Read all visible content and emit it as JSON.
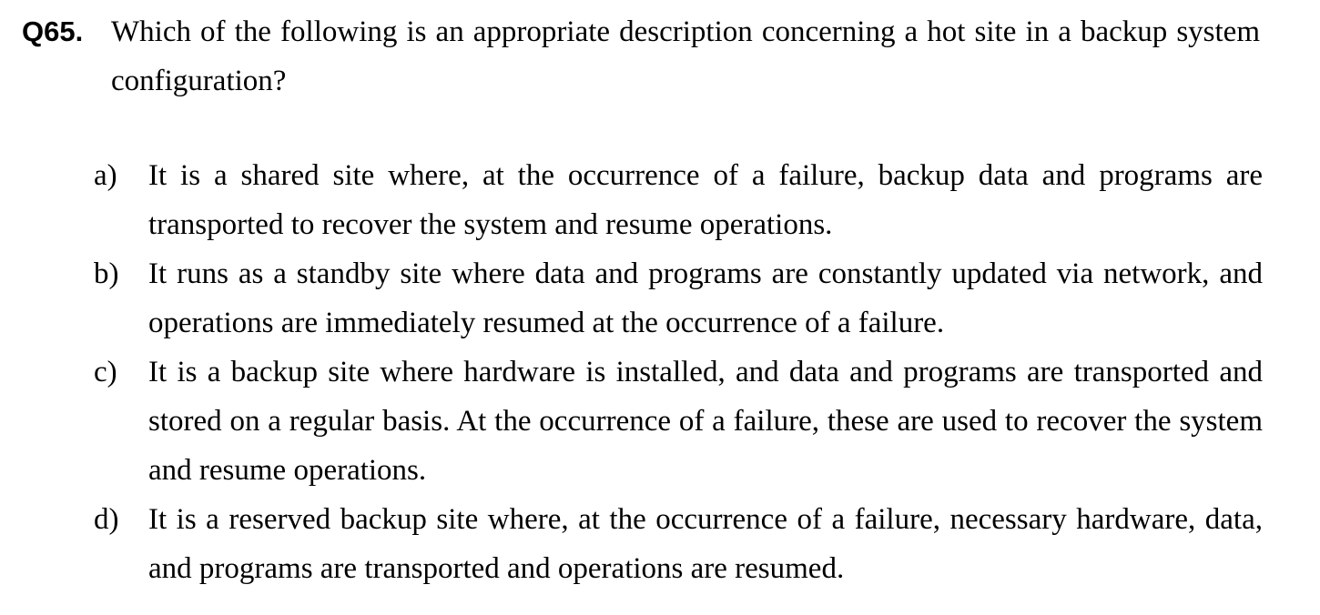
{
  "question": {
    "number": "Q65.",
    "text": "Which of the following is an appropriate description concerning a hot site in a backup system configuration?"
  },
  "options": [
    {
      "letter": "a)",
      "text": "It is a shared site where, at the occurrence of a failure, backup data and programs are transported to recover the system and resume operations."
    },
    {
      "letter": "b)",
      "text": "It runs as a standby site where data and programs are constantly updated via network, and operations are immediately resumed at the occurrence of a failure."
    },
    {
      "letter": "c)",
      "text": "It is a backup site where hardware is installed, and data and programs are transported and stored on a regular basis.   At the occurrence of a failure, these are used to recover the system and resume operations."
    },
    {
      "letter": "d)",
      "text": "It is a reserved backup site where, at the occurrence of a failure, necessary hardware, data, and programs are transported and operations are resumed."
    }
  ]
}
